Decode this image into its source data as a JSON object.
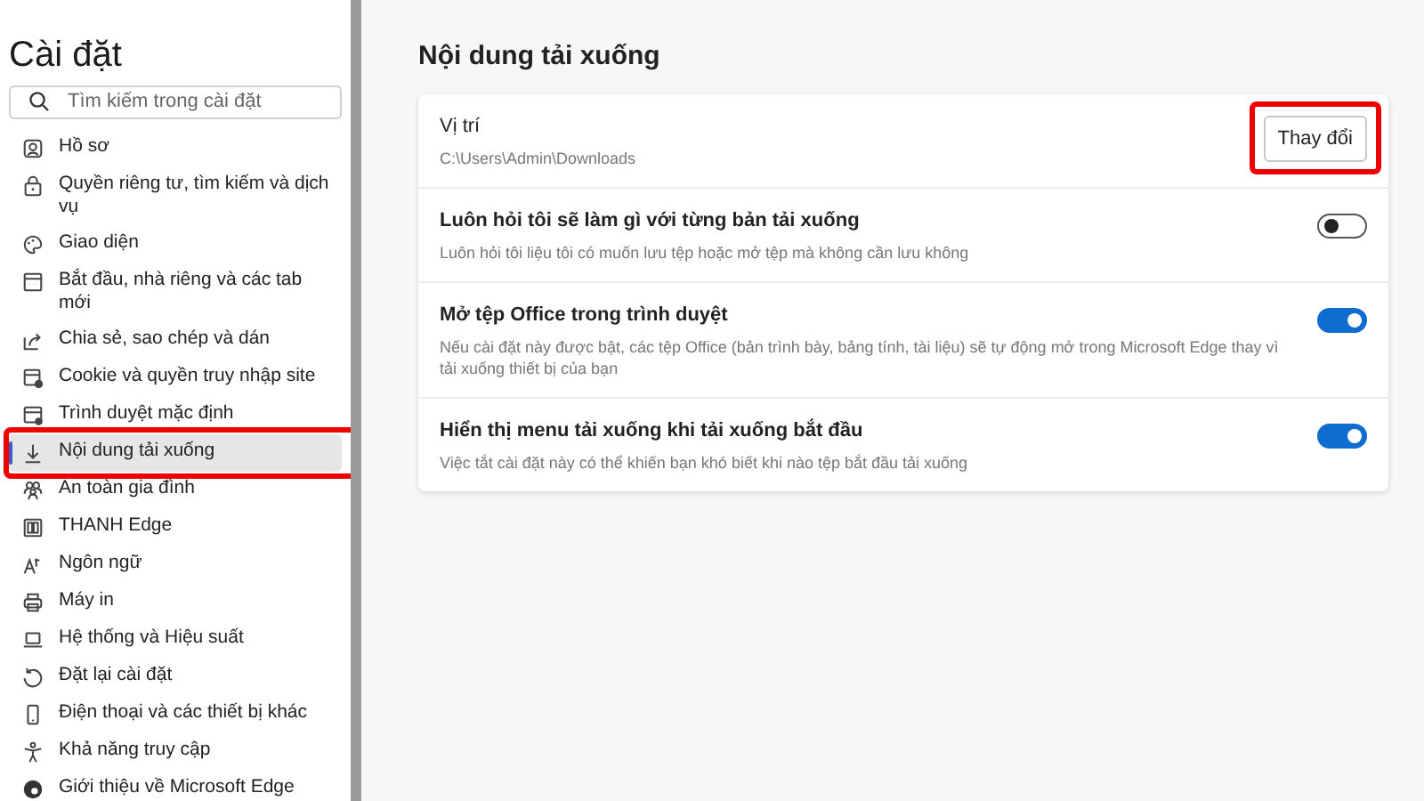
{
  "sidebar": {
    "title": "Cài đặt",
    "search": {
      "placeholder": "Tìm kiếm trong cài đặt"
    },
    "items": [
      {
        "label": "Hồ sơ",
        "selected": false,
        "highlighted": false
      },
      {
        "label": "Quyền riêng tư, tìm kiếm và dịch vụ",
        "selected": false,
        "highlighted": false
      },
      {
        "label": "Giao diện",
        "selected": false,
        "highlighted": false
      },
      {
        "label": "Bắt đầu, nhà riêng và các tab mới",
        "selected": false,
        "highlighted": false
      },
      {
        "label": "Chia sẻ, sao chép và dán",
        "selected": false,
        "highlighted": false
      },
      {
        "label": "Cookie và quyền truy nhập site",
        "selected": false,
        "highlighted": false
      },
      {
        "label": "Trình duyệt mặc định",
        "selected": false,
        "highlighted": false
      },
      {
        "label": "Nội dung tải xuống",
        "selected": true,
        "highlighted": true
      },
      {
        "label": "An toàn gia đình",
        "selected": false,
        "highlighted": false
      },
      {
        "label": "THANH Edge",
        "selected": false,
        "highlighted": false
      },
      {
        "label": "Ngôn ngữ",
        "selected": false,
        "highlighted": false
      },
      {
        "label": "Máy in",
        "selected": false,
        "highlighted": false
      },
      {
        "label": "Hệ thống và Hiệu suất",
        "selected": false,
        "highlighted": false
      },
      {
        "label": "Đặt lại cài đặt",
        "selected": false,
        "highlighted": false
      },
      {
        "label": "Điện thoại và các thiết bị khác",
        "selected": false,
        "highlighted": false
      },
      {
        "label": "Khả năng truy cập",
        "selected": false,
        "highlighted": false
      },
      {
        "label": "Giới thiệu về Microsoft Edge",
        "selected": false,
        "highlighted": false
      }
    ]
  },
  "main": {
    "title": "Nội dung tải xuống",
    "settings": [
      {
        "kind": "button",
        "label": "Vị trí",
        "description": "C:\\Users\\Admin\\Downloads",
        "button": "Thay đổi",
        "highlighted": true
      },
      {
        "kind": "toggle",
        "label": "Luôn hỏi tôi sẽ làm gì với từng bản tải xuống",
        "description": "Luôn hỏi tôi liệu tôi có muốn lưu tệp hoặc mở tệp mà không cần lưu không",
        "on": false
      },
      {
        "kind": "toggle",
        "label": "Mở tệp Office trong trình duyệt",
        "description": "Nếu cài đặt này được bật, các tệp Office (bản trình bày, bảng tính, tài liệu) sẽ tự động mở trong Microsoft Edge thay vì tải xuống thiết bị của bạn",
        "on": true
      },
      {
        "kind": "toggle",
        "label": "Hiển thị menu tải xuống khi tải xuống bắt đầu",
        "description": "Việc tắt cài đặt này có thể khiến bạn khó biết khi nào tệp bắt đầu tải xuống",
        "on": true
      }
    ]
  }
}
